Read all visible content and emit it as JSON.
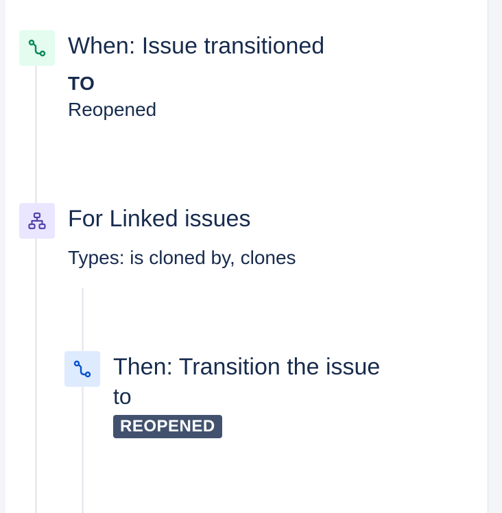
{
  "colors": {
    "trigger_bg": "#e3fcef",
    "trigger_icon": "#00875a",
    "branch_bg": "#eae6ff",
    "branch_icon": "#5243aa",
    "action_bg": "#deebff",
    "action_icon": "#0052cc",
    "lozenge_bg": "#42526e",
    "text": "#172b4d"
  },
  "trigger": {
    "icon": "transition-icon",
    "title": "When: Issue transitioned",
    "to_label": "TO",
    "to_value": "Reopened"
  },
  "branch": {
    "icon": "hierarchy-icon",
    "title": "For Linked issues",
    "types": "Types: is cloned by, clones"
  },
  "action": {
    "icon": "transition-icon",
    "title": "Then: Transition the issue",
    "to_label": "to",
    "status": "REOPENED"
  }
}
